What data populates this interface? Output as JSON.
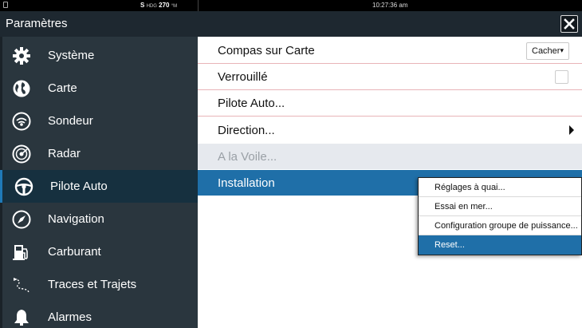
{
  "status_bar": {
    "heading_prefix": "S",
    "heading_small": "HDG",
    "heading_value": "270",
    "heading_unit": "°M",
    "time": "10:27:36 am"
  },
  "title_bar": {
    "title": "Paramètres",
    "close_icon": "close-icon"
  },
  "sidebar": {
    "items": [
      {
        "label": "Système",
        "icon": "gear-icon"
      },
      {
        "label": "Carte",
        "icon": "globe-icon"
      },
      {
        "label": "Sondeur",
        "icon": "sonar-icon"
      },
      {
        "label": "Radar",
        "icon": "radar-icon"
      },
      {
        "label": "Pilote Auto",
        "icon": "steering-wheel-icon"
      },
      {
        "label": "Navigation",
        "icon": "compass-icon"
      },
      {
        "label": "Carburant",
        "icon": "fuel-pump-icon"
      },
      {
        "label": "Traces et Trajets",
        "icon": "track-icon"
      },
      {
        "label": "Alarmes",
        "icon": "bell-icon"
      }
    ],
    "selected_index": 4
  },
  "main_menu": {
    "compass_label": "Compas sur Carte",
    "compass_value": "Cacher",
    "locked_label": "Verrouillé",
    "autopilot_label": "Pilote Auto...",
    "direction_label": "Direction...",
    "sailing_label": "A la Voile...",
    "installation_label": "Installation"
  },
  "submenu": {
    "items": [
      {
        "label": "Réglages à quai..."
      },
      {
        "label": "Essai en mer..."
      },
      {
        "label": "Configuration groupe de puissance..."
      },
      {
        "label": "Reset..."
      }
    ],
    "selected_index": 3
  },
  "colors": {
    "accent": "#1f6fa8",
    "sidebar_bg": "#2a363e",
    "title_bg": "#1e2830"
  }
}
